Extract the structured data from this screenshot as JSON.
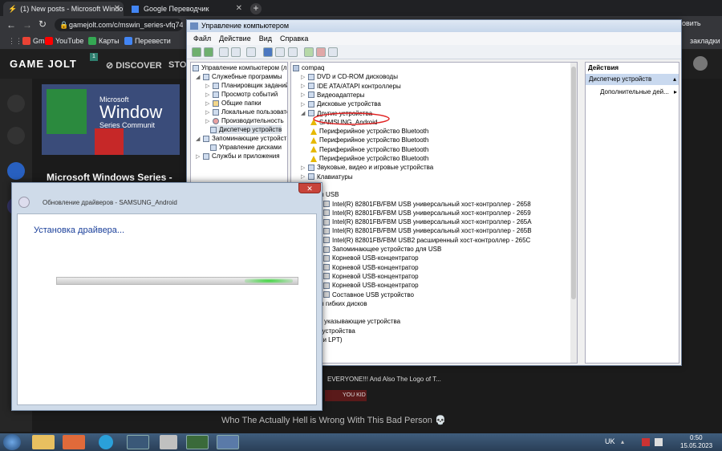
{
  "browser": {
    "tabs": [
      {
        "title": "(1) New posts - Microsoft Windo"
      },
      {
        "title": "Google Переводчик"
      }
    ],
    "url": "gamejolt.com/c/mswin_series-vfq74...",
    "bookmarks": [
      "Gmail",
      "YouTube",
      "Карты",
      "Перевести"
    ],
    "bookmarks_right": "закладки",
    "update_label": "овить"
  },
  "gamejolt": {
    "logo": "GAME JOLT",
    "notif_count": "1",
    "nav_discover": "DISCOVER",
    "nav_store": "STO",
    "banner_title": "Microsoft Windows Series -",
    "banner_logo_line1": "Microsoft",
    "banner_logo_line2": "Window",
    "banner_logo_line3": "Series Communit",
    "comment_text": "EVERYONE!!! And Also The Logo of T...",
    "comment_sub": "YOU KID",
    "bottom_text": "Who The Actually Hell is Wrong With This Bad Person 💀"
  },
  "mmc": {
    "title": "Управление компьютером",
    "menu": [
      "Файл",
      "Действие",
      "Вид",
      "Справка"
    ],
    "left_tree": [
      "Управление компьютером (л",
      "Служебные программы",
      "Планировщик заданий",
      "Просмотр событий",
      "Общие папки",
      "Локальные пользовате",
      "Производительность",
      "Диспетчер устройств",
      "Запоминающие устройст",
      "Управление дисками",
      "Службы и приложения"
    ],
    "device_tree": [
      "compaq",
      "DVD и CD-ROM дисководы",
      "IDE ATA/ATAPI контроллеры",
      "Видеоадаптеры",
      "Дисковые устройства",
      "Другие устройства",
      "SAMSUNG_Android",
      "Периферийное устройство Bluetooth",
      "Периферийное устройство Bluetooth",
      "Периферийное устройство Bluetooth",
      "Периферийное устройство Bluetooth",
      "Звуковые, видео и игровые устройства",
      "Клавиатуры",
      "мпьютер",
      "нтроллеры USB",
      "Intel(R) 82801FB/FBM USB универсальный хост-контроллер - 2658",
      "Intel(R) 82801FB/FBM USB универсальный хост-контроллер - 2659",
      "Intel(R) 82801FB/FBM USB универсальный хост-контроллер - 265A",
      "Intel(R) 82801FB/FBM USB универсальный хост-контроллер - 265B",
      "Intel(R) 82801FB/FBM USB2 расширенный хост-контроллер - 265C",
      "Запоминающее устройство для USB",
      "Корневой USB-концентратор",
      "Корневой USB-концентратор",
      "Корневой USB-концентратор",
      "Корневой USB-концентратор",
      "Составное USB устройство",
      "нтроллеры гибких дисков",
      "ниторы",
      "ши и иные указывающие устройства",
      "реносные устройства",
      "рты (COM и LPT)",
      "оцессоры"
    ],
    "actions_header": "Действия",
    "actions_item": "Диспетчер устройств",
    "actions_more": "Дополнительные дей..."
  },
  "dialog": {
    "title": "Обновление драйверов - SAMSUNG_Android",
    "heading": "Установка драйвера...",
    "close": "✕",
    "progress": 1.0
  },
  "taskbar": {
    "lang": "UK",
    "time": "0:50",
    "date": "15.05.2023"
  },
  "colors": {
    "accent": "#2b6fd1",
    "highlight_circle": "#e02020",
    "warning": "#e6b800"
  }
}
